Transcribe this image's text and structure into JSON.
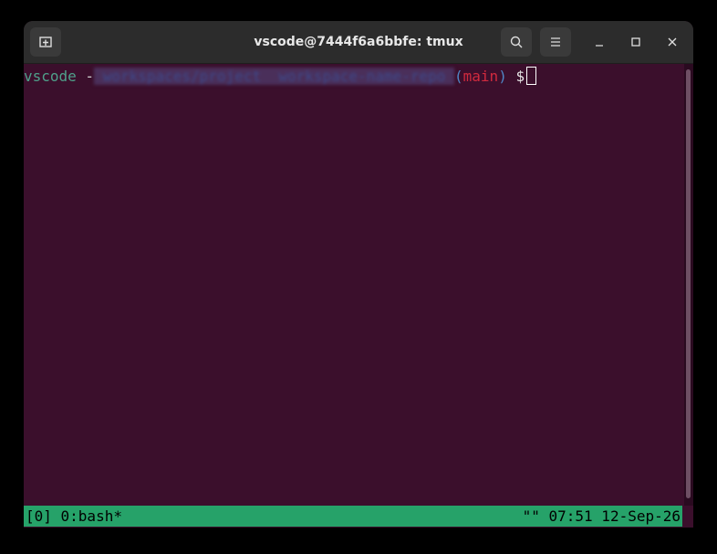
{
  "window": {
    "title": "vscode@7444f6a6bbfe: tmux"
  },
  "titlebar": {
    "new_tab_icon": "new-tab-icon",
    "search_icon": "search-icon",
    "menu_icon": "hamburger-menu-icon",
    "minimize_icon": "minimize-icon",
    "maximize_icon": "maximize-icon",
    "close_icon": "close-icon"
  },
  "terminal": {
    "prompt_user": "vscode",
    "prompt_sep": " -",
    "prompt_path_redacted": " workspaces/project  workspace-name-repo ",
    "prompt_paren_open": "(",
    "prompt_branch": "main",
    "prompt_paren_close": ")",
    "prompt_symbol": " $ "
  },
  "statusbar": {
    "left": "[0] 0:bash*",
    "right": "\"\" 07:51 12-Sep-26"
  },
  "colors": {
    "terminal_bg": "#3b0f2c",
    "status_bg": "#26a269",
    "user": "#4fa08a",
    "branch": "#d12a3e"
  }
}
